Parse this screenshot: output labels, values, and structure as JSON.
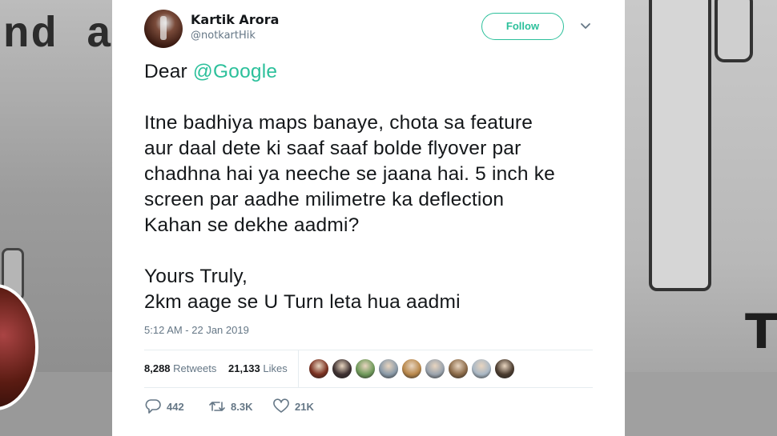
{
  "background": {
    "left_text": "nd a",
    "right_text": "T"
  },
  "tweet": {
    "author": {
      "name": "Kartik Arora",
      "handle": "@notkartHik"
    },
    "follow_label": "Follow",
    "greeting": "Dear ",
    "mention": "@Google",
    "body_lines": [
      "Itne badhiya maps banaye, chota sa feature",
      "aur daal dete ki saaf saaf bolde flyover par",
      "chadhna hai ya neeche se jaana hai. 5 inch ke",
      "screen par aadhe milimetre ka deflection",
      "Kahan se dekhe aadmi?"
    ],
    "signoff_lines": [
      "Yours Truly,",
      "2km aage se U Turn leta hua aadmi"
    ],
    "timestamp": "5:12 AM - 22 Jan 2019",
    "stats": {
      "retweets_count": "8,288",
      "retweets_label": "Retweets",
      "likes_count": "21,133",
      "likes_label": "Likes"
    },
    "liker_colors": [
      "#7a3020",
      "#3d3030",
      "#6f9a5a",
      "#8a9aa8",
      "#b8874a",
      "#9aa3ad",
      "#8b6a48",
      "#a9b7c4",
      "#4a3b2e"
    ],
    "actions": {
      "replies": "442",
      "retweets": "8.3K",
      "likes": "21K"
    },
    "accent_color": "#2cc09b"
  }
}
